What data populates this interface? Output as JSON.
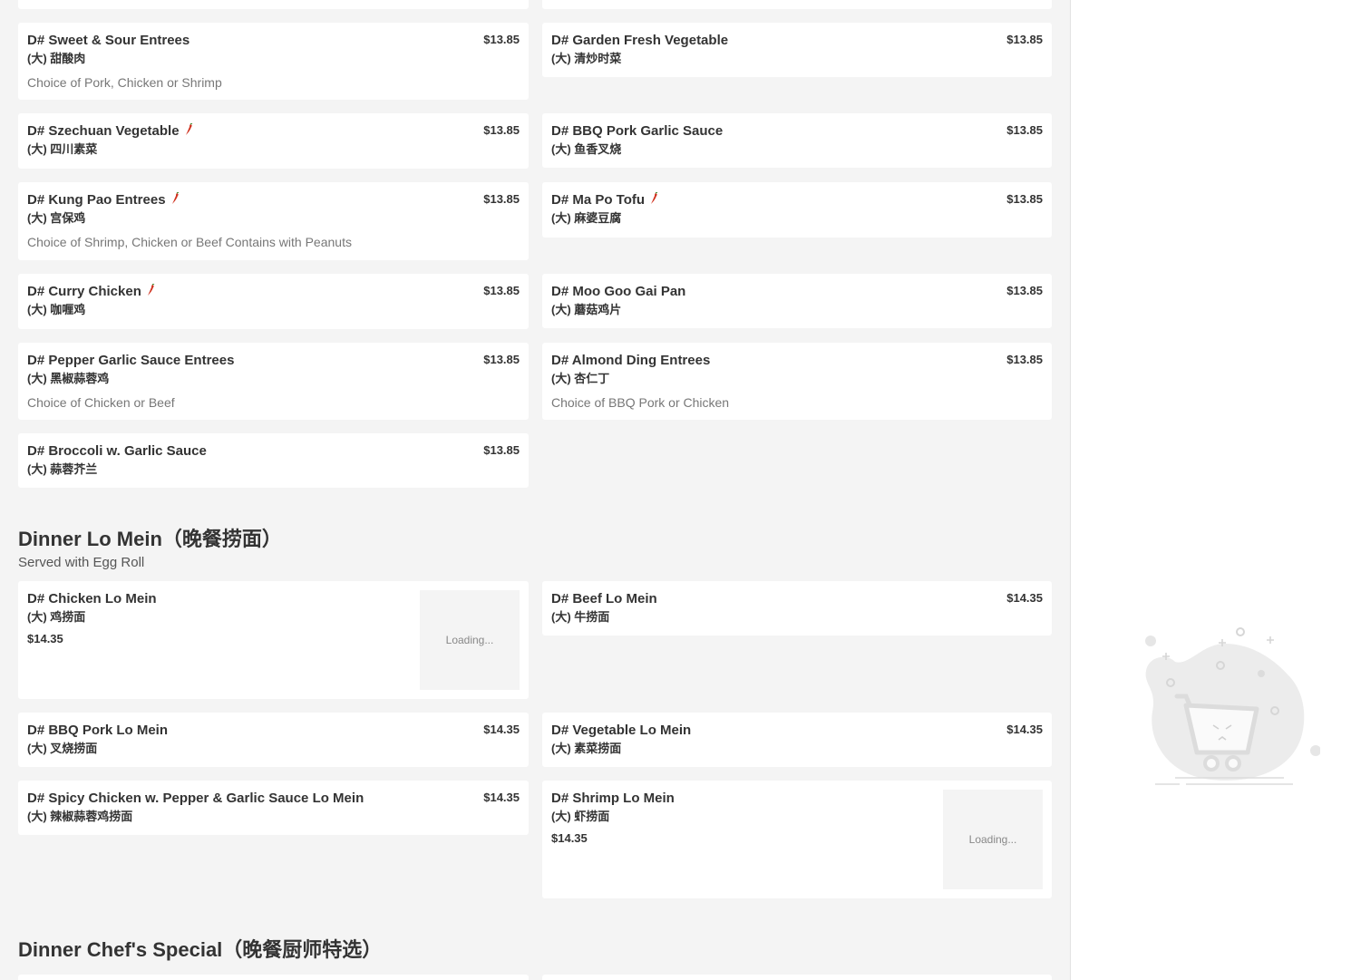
{
  "sections": [
    {
      "items": [
        {
          "name": "D# Sweet & Sour Entrees",
          "cn": "(大) 甜酸肉",
          "price": "$13.85",
          "desc": "Choice of Pork, Chicken or Shrimp",
          "spicy": false
        },
        {
          "name": "D# Garden Fresh Vegetable",
          "cn": "(大) 清炒时菜",
          "price": "$13.85",
          "desc": "",
          "spicy": false
        },
        {
          "name": "D# Szechuan Vegetable",
          "cn": "(大) 四川素菜",
          "price": "$13.85",
          "desc": "",
          "spicy": true
        },
        {
          "name": "D# BBQ Pork Garlic Sauce",
          "cn": "(大) 鱼香叉烧",
          "price": "$13.85",
          "desc": "",
          "spicy": false
        },
        {
          "name": "D# Kung Pao Entrees",
          "cn": "(大) 宫保鸡",
          "price": "$13.85",
          "desc": "Choice of Shrimp, Chicken or Beef Contains with Peanuts",
          "spicy": true
        },
        {
          "name": "D# Ma Po Tofu",
          "cn": "(大) 麻婆豆腐",
          "price": "$13.85",
          "desc": "",
          "spicy": true
        },
        {
          "name": "D# Curry Chicken",
          "cn": "(大) 咖喱鸡",
          "price": "$13.85",
          "desc": "",
          "spicy": true
        },
        {
          "name": "D# Moo Goo Gai Pan",
          "cn": "(大) 蘑菇鸡片",
          "price": "$13.85",
          "desc": "",
          "spicy": false
        },
        {
          "name": "D# Pepper Garlic Sauce Entrees",
          "cn": "(大) 黑椒蒜蓉鸡",
          "price": "$13.85",
          "desc": "Choice of Chicken or Beef",
          "spicy": false
        },
        {
          "name": "D# Almond Ding Entrees",
          "cn": "(大) 杏仁丁",
          "price": "$13.85",
          "desc": "Choice of BBQ Pork or Chicken",
          "spicy": false
        },
        {
          "name": "D# Broccoli w. Garlic Sauce",
          "cn": "(大) 蒜蓉芥兰",
          "price": "$13.85",
          "desc": "",
          "spicy": false
        }
      ]
    },
    {
      "title": "Dinner Lo Mein（晚餐捞面）",
      "subtitle": "Served with Egg Roll",
      "items": [
        {
          "name": "D# Chicken Lo Mein",
          "cn": "(大) 鸡捞面",
          "price": "$14.35",
          "image_status": "Loading..."
        },
        {
          "name": "D# Beef Lo Mein",
          "cn": "(大) 牛捞面",
          "price": "$14.35"
        },
        {
          "name": "D# BBQ Pork Lo Mein",
          "cn": "(大) 叉烧捞面",
          "price": "$14.35"
        },
        {
          "name": "D# Vegetable Lo Mein",
          "cn": "(大) 素菜捞面",
          "price": "$14.35"
        },
        {
          "name": "D# Spicy Chicken w. Pepper & Garlic Sauce Lo Mein",
          "cn": "(大) 辣椒蒜蓉鸡捞面",
          "price": "$14.35"
        },
        {
          "name": "D# Shrimp Lo Mein",
          "cn": "(大) 虾捞面",
          "price": "$14.35",
          "image_status": "Loading..."
        }
      ]
    },
    {
      "title": "Dinner Chef's Special（晚餐厨师特选）"
    }
  ],
  "colors": {
    "background": "#f4f4f4",
    "card": "#ffffff",
    "text": "#333333",
    "muted": "#777777",
    "pepper": "#d0311e"
  },
  "cart": {
    "icon": "empty-cart-illustration"
  }
}
